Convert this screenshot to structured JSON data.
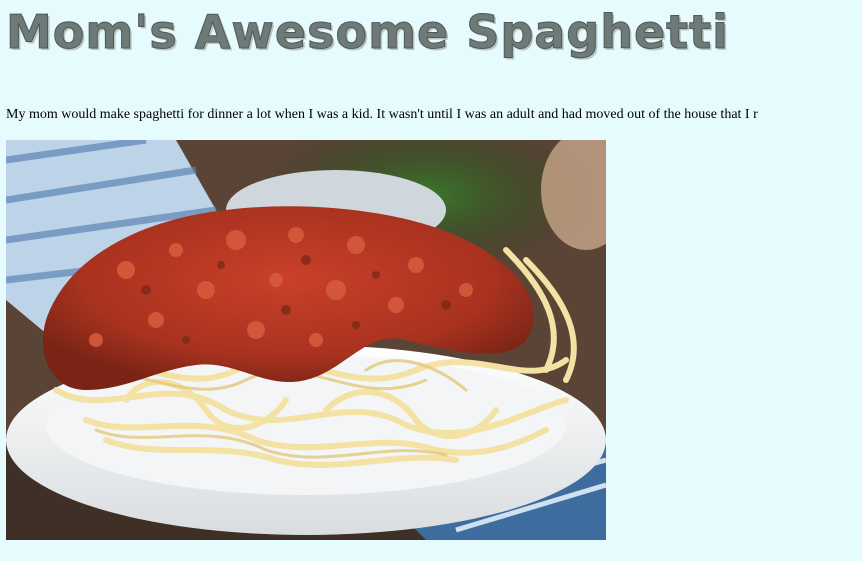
{
  "page": {
    "title": "Mom's Awesome Spaghetti",
    "intro": "My mom would make spaghetti for dinner a lot when I was a kid. It wasn't until I was an adult and had moved out of the house that I r"
  },
  "image": {
    "subject": "spaghetti-with-meat-sauce-photo"
  },
  "colors": {
    "background": "#e6fbfd",
    "title": "#6e7a78"
  }
}
